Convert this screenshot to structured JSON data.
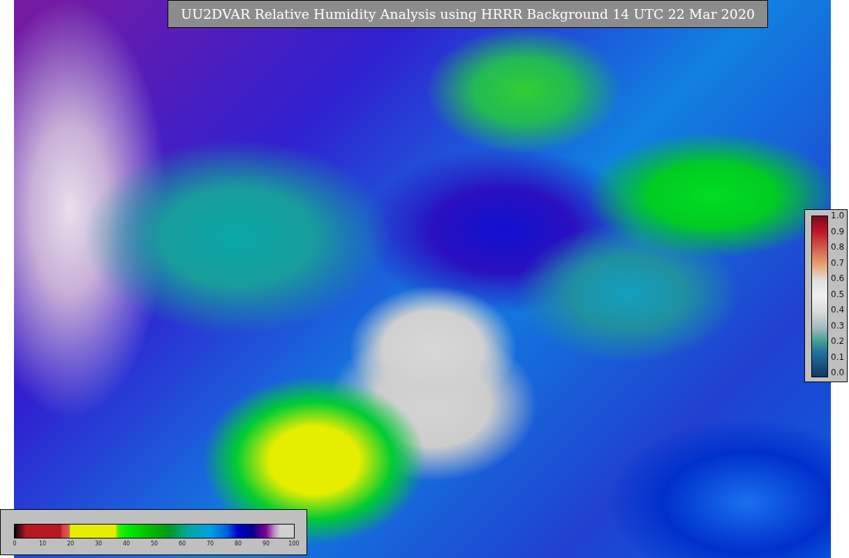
{
  "title": "UU2DVAR Relative Humidity Analysis using HRRR Background 14 UTC 22 Mar 2020",
  "humidity_colorbar": {
    "ticks": [
      "0",
      "10",
      "20",
      "30",
      "40",
      "50",
      "60",
      "70",
      "80",
      "90",
      "100"
    ]
  },
  "station_colorbar": {
    "ticks": [
      "1.0",
      "0.9",
      "0.8",
      "0.7",
      "0.6",
      "0.5",
      "0.4",
      "0.3",
      "0.2",
      "0.1",
      "0.0"
    ]
  }
}
